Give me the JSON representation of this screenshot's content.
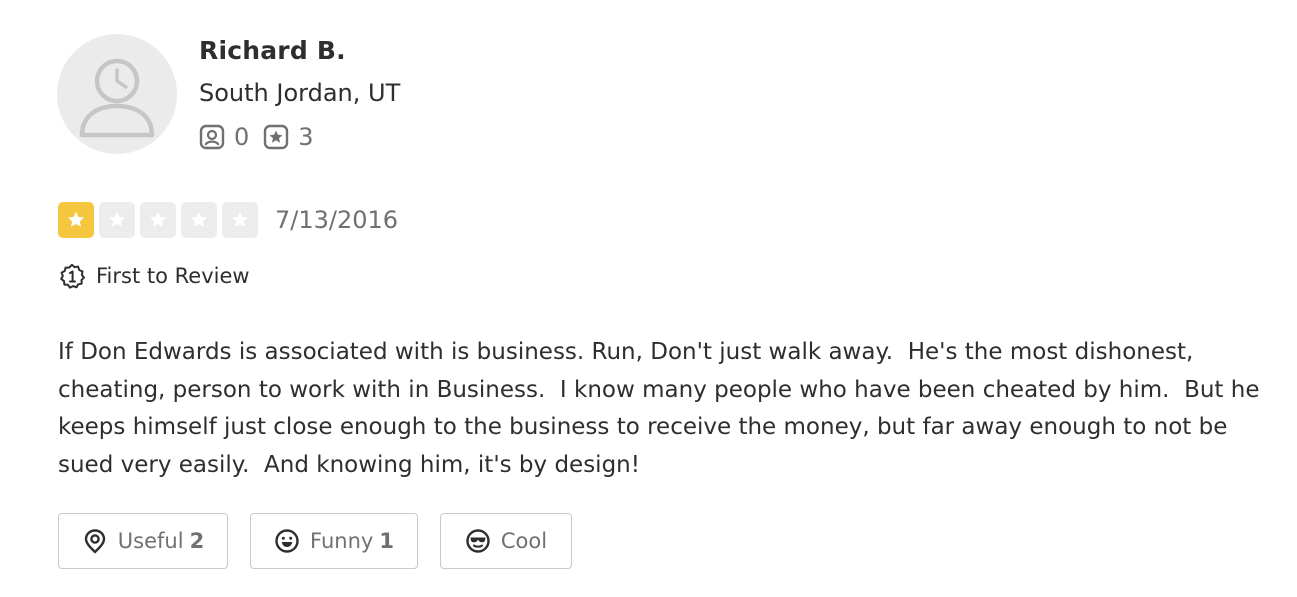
{
  "reviewer": {
    "name": "Richard B.",
    "location": "South Jordan, UT",
    "friends_count": "0",
    "reviews_count": "3"
  },
  "review": {
    "rating": 1,
    "max_rating": 5,
    "date": "7/13/2016",
    "badge_label": "First to Review",
    "text": "If Don Edwards is associated with is business. Run, Don't just walk away.  He's the most dishonest, cheating, person to work with in Business.  I know many people who have been cheated by him.  But he keeps himself just close enough to the business to receive the money, but far away enough to not be sued very easily.  And knowing him, it's by design!"
  },
  "reactions": {
    "useful": {
      "label": "Useful",
      "count": "2",
      "icon": "lightbulb-icon"
    },
    "funny": {
      "label": "Funny",
      "count": "1",
      "icon": "smile-icon"
    },
    "cool": {
      "label": "Cool",
      "count": "",
      "icon": "sunglasses-icon"
    }
  },
  "colors": {
    "star_filled": "#f5c73f",
    "star_empty": "#ececec",
    "text_primary": "#2d2e2f",
    "text_secondary": "#6e7072",
    "border": "#c8c9ca"
  }
}
